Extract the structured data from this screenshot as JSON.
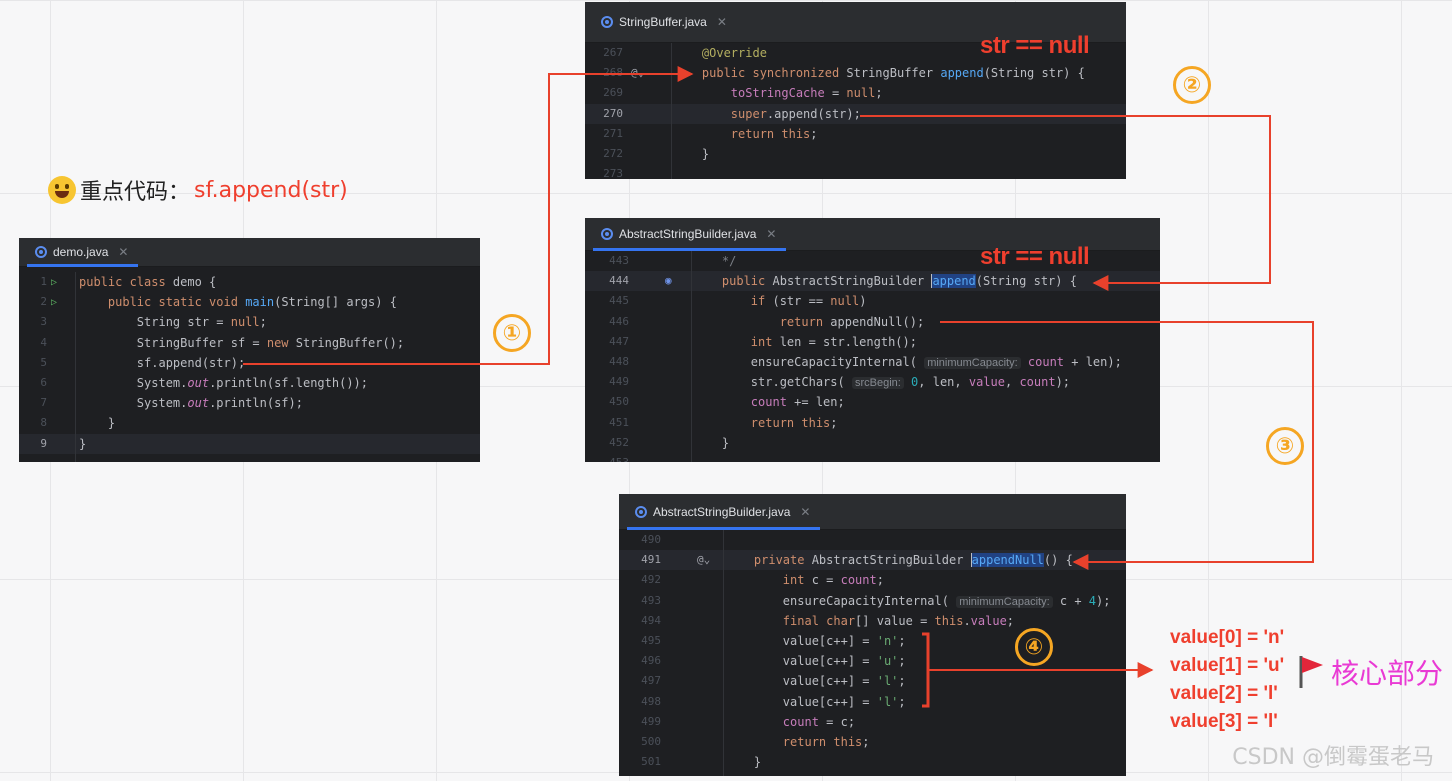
{
  "keycode": {
    "emoji": "grinning-face-icon",
    "label": "重点代码：",
    "code": "sf.append(str)"
  },
  "panels": [
    {
      "id": "demo",
      "tab": "demo.java",
      "lines": [
        {
          "n": "1",
          "code": "<span class=\"kw\">public class</span> demo {",
          "gutter": "run"
        },
        {
          "n": "2",
          "code": "    <span class=\"kw\">public static void</span> <span class=\"fn\">main</span>(String[] args) {",
          "gutter": "run"
        },
        {
          "n": "3",
          "code": "        String str = <span class=\"kw\">null</span>;"
        },
        {
          "n": "4",
          "code": "        StringBuffer sf = <span class=\"kw\">new</span> StringBuffer();"
        },
        {
          "n": "5",
          "code": "        sf.append(str);"
        },
        {
          "n": "6",
          "code": "        System.<span class=\"ital\">out</span>.println(sf.length());"
        },
        {
          "n": "7",
          "code": "        System.<span class=\"ital\">out</span>.println(sf);"
        },
        {
          "n": "8",
          "code": "    }"
        },
        {
          "n": "9",
          "code": "}",
          "current": true
        }
      ]
    },
    {
      "id": "stringbuffer",
      "tab": "StringBuffer.java",
      "lines": [
        {
          "n": "267",
          "code": "    <span class=\"ann\">@Override</span>"
        },
        {
          "n": "268",
          "code": "    <span class=\"kw\">public synchronized</span> StringBuffer <span class=\"fn\">append</span>(String str) {",
          "gutter": "@"
        },
        {
          "n": "269",
          "code": "        <span class=\"fld\">toStringCache</span> = <span class=\"kw\">null</span>;"
        },
        {
          "n": "270",
          "code": "        <span class=\"kw\">super</span>.append(str);",
          "current": true
        },
        {
          "n": "271",
          "code": "        <span class=\"kw\">return this</span>;"
        },
        {
          "n": "272",
          "code": "    }"
        },
        {
          "n": "273",
          "code": ""
        }
      ]
    },
    {
      "id": "asb1",
      "tab": "AbstractStringBuilder.java",
      "lines": [
        {
          "n": "443",
          "code": "    <span class=\"cmt\">*/</span>"
        },
        {
          "n": "444",
          "code": "    <span class=\"kw\">public</span> AbstractStringBuilder <span class=\"caret\"></span><span class=\"fn hl\">append</span>(String str) {",
          "current": true,
          "gutter": "o"
        },
        {
          "n": "445",
          "code": "        <span class=\"kw\">if</span> (str == <span class=\"kw\">null</span>)"
        },
        {
          "n": "446",
          "code": "            <span class=\"kw\">return</span> appendNull();"
        },
        {
          "n": "447",
          "code": "        <span class=\"kw\">int</span> len = str.length();"
        },
        {
          "n": "448",
          "code": "        ensureCapacityInternal( <span class=\"hint\">minimumCapacity:</span> <span class=\"fld\">count</span> + len);"
        },
        {
          "n": "449",
          "code": "        str.getChars( <span class=\"hint\">srcBegin:</span> <span class=\"num\">0</span>, len, <span class=\"fld\">value</span>, <span class=\"fld\">count</span>);"
        },
        {
          "n": "450",
          "code": "        <span class=\"fld\">count</span> += len;"
        },
        {
          "n": "451",
          "code": "        <span class=\"kw\">return this</span>;"
        },
        {
          "n": "452",
          "code": "    }"
        },
        {
          "n": "453",
          "code": ""
        }
      ]
    },
    {
      "id": "asb2",
      "tab": "AbstractStringBuilder.java",
      "lines": [
        {
          "n": "490",
          "code": ""
        },
        {
          "n": "491",
          "code": "    <span class=\"kw\">private</span> AbstractStringBuilder <span class=\"caret\"></span><span class=\"fn hl\">appendNull</span>() {",
          "current": true,
          "gutter": "@"
        },
        {
          "n": "492",
          "code": "        <span class=\"kw\">int</span> c = <span class=\"fld\">count</span>;"
        },
        {
          "n": "493",
          "code": "        ensureCapacityInternal( <span class=\"hint\">minimumCapacity:</span> c + <span class=\"num\">4</span>);"
        },
        {
          "n": "494",
          "code": "        <span class=\"kw\">final char</span>[] value = <span class=\"kw\">this</span>.<span class=\"fld\">value</span>;"
        },
        {
          "n": "495",
          "code": "        value[c++] = <span class=\"str\">'n'</span>;"
        },
        {
          "n": "496",
          "code": "        value[c++] = <span class=\"str\">'u'</span>;"
        },
        {
          "n": "497",
          "code": "        value[c++] = <span class=\"str\">'l'</span>;"
        },
        {
          "n": "498",
          "code": "        value[c++] = <span class=\"str\">'l'</span>;"
        },
        {
          "n": "499",
          "code": "        <span class=\"fld\">count</span> = c;"
        },
        {
          "n": "500",
          "code": "        <span class=\"kw\">return this</span>;"
        },
        {
          "n": "501",
          "code": "    }"
        }
      ]
    }
  ],
  "notes": {
    "null_check_1": "str == null",
    "null_check_2": "str == null"
  },
  "steps": [
    "①",
    "②",
    "③",
    "④"
  ],
  "values": [
    "value[0] = 'n'",
    "value[1] = 'u'",
    "value[2] = 'l'",
    "value[3] = 'l'"
  ],
  "core": {
    "flag": "red-flag-icon",
    "label": "核心部分"
  },
  "watermark": "CSDN @倒霉蛋老马",
  "colors": {
    "arrow": "#e8412c",
    "step": "#f5a623",
    "core": "#e93ad4",
    "note": "#ef3f2e"
  }
}
